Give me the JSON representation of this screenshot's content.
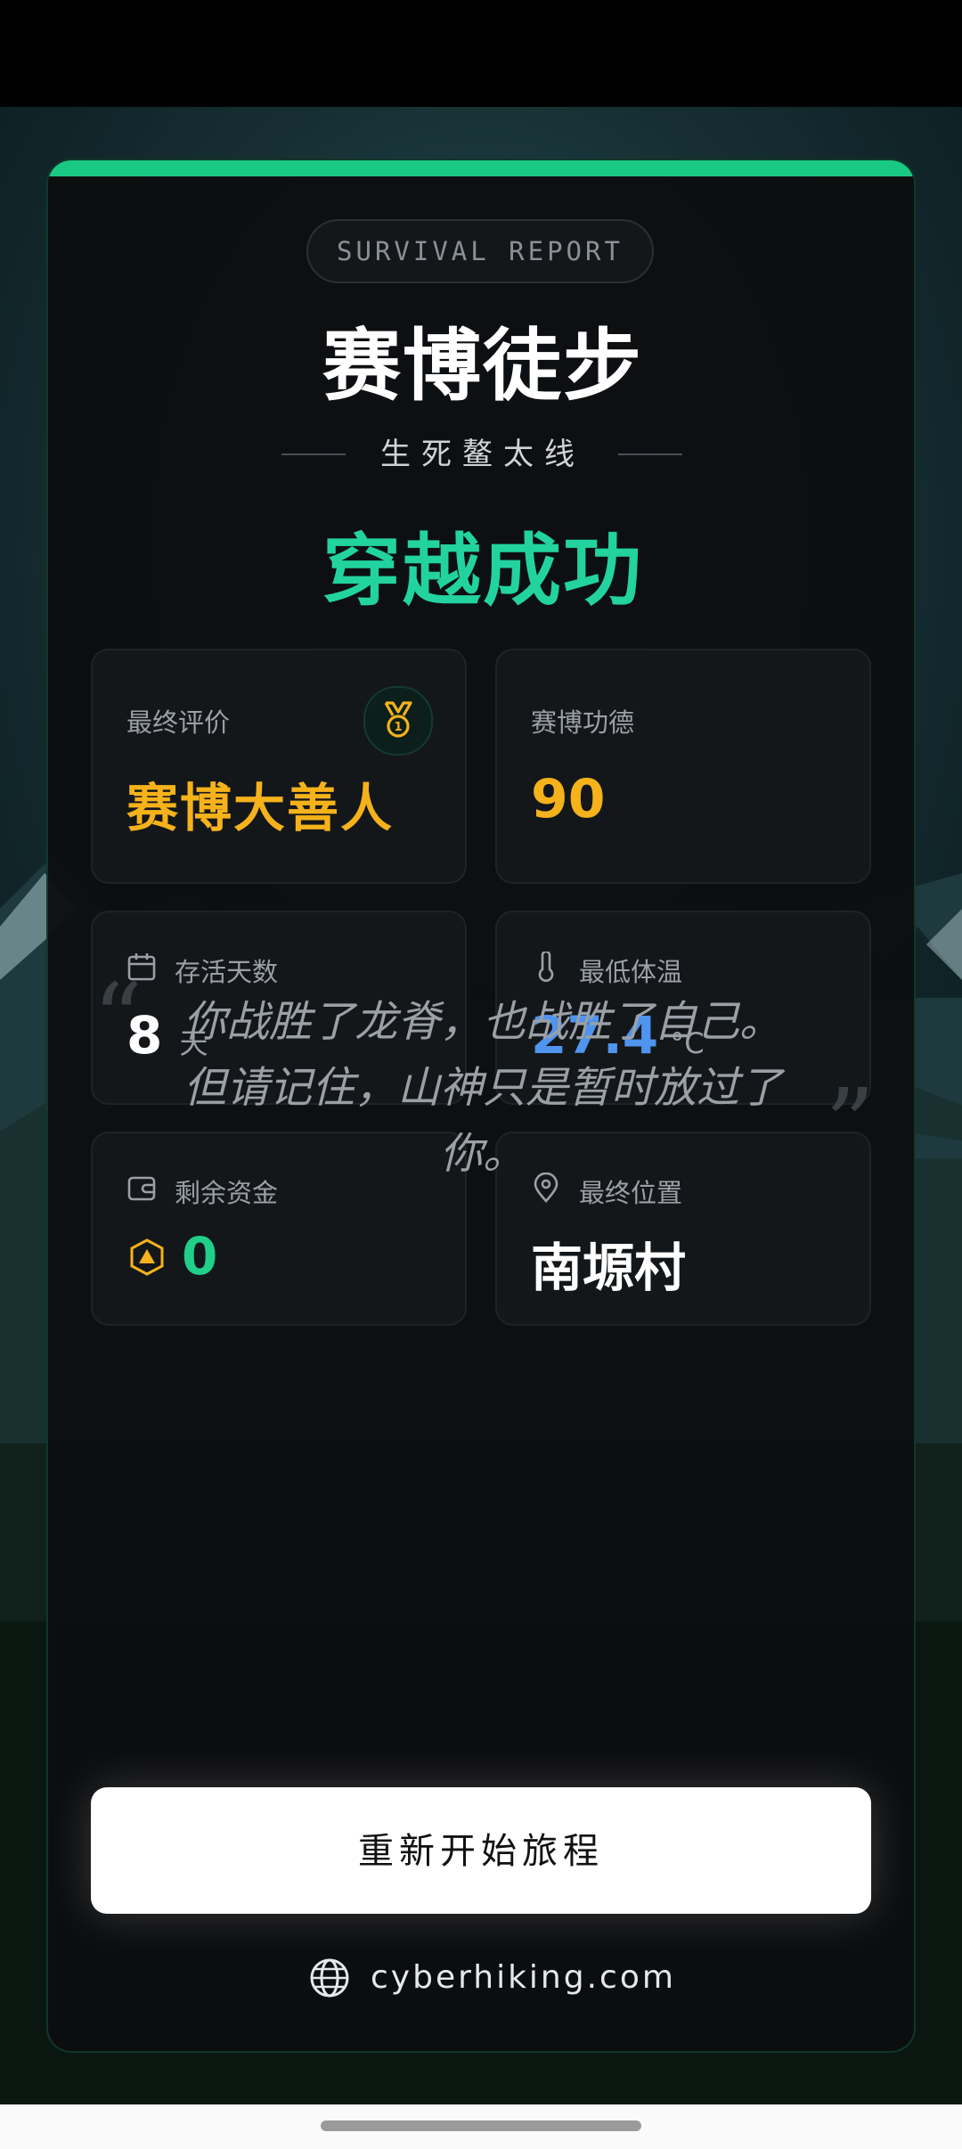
{
  "report": {
    "badge": "SURVIVAL REPORT",
    "title": "赛博徒步",
    "subtitle": "生死鳌太线",
    "status": "穿越成功"
  },
  "stats": {
    "rating": {
      "label": "最终评价",
      "value": "赛博大善人",
      "icon": "medal-icon"
    },
    "merit": {
      "label": "赛博功德",
      "value": "90"
    },
    "days": {
      "label": "存活天数",
      "value": "8",
      "unit": "天",
      "icon": "calendar-icon"
    },
    "temperature": {
      "label": "最低体温",
      "value": "27.4",
      "unit": "°C",
      "icon": "thermometer-icon"
    },
    "funds": {
      "label": "剩余资金",
      "value": "0",
      "icon": "wallet-icon",
      "coin_icon": "coin-icon"
    },
    "location": {
      "label": "最终位置",
      "value": "南塬村",
      "icon": "location-pin-icon"
    }
  },
  "quote": "你战胜了龙脊，也战胜了自己。但请记住，山神只是暂时放过了你。",
  "actions": {
    "restart_label": "重新开始旅程"
  },
  "footer": {
    "site": "cyberhiking.com",
    "icon": "globe-icon"
  },
  "colors": {
    "accent_green": "#19c983",
    "status_green": "#22d3a0",
    "gold": "#f5b21b",
    "temperature_blue": "#4f94ef",
    "funds_green": "#1fcf8a"
  }
}
